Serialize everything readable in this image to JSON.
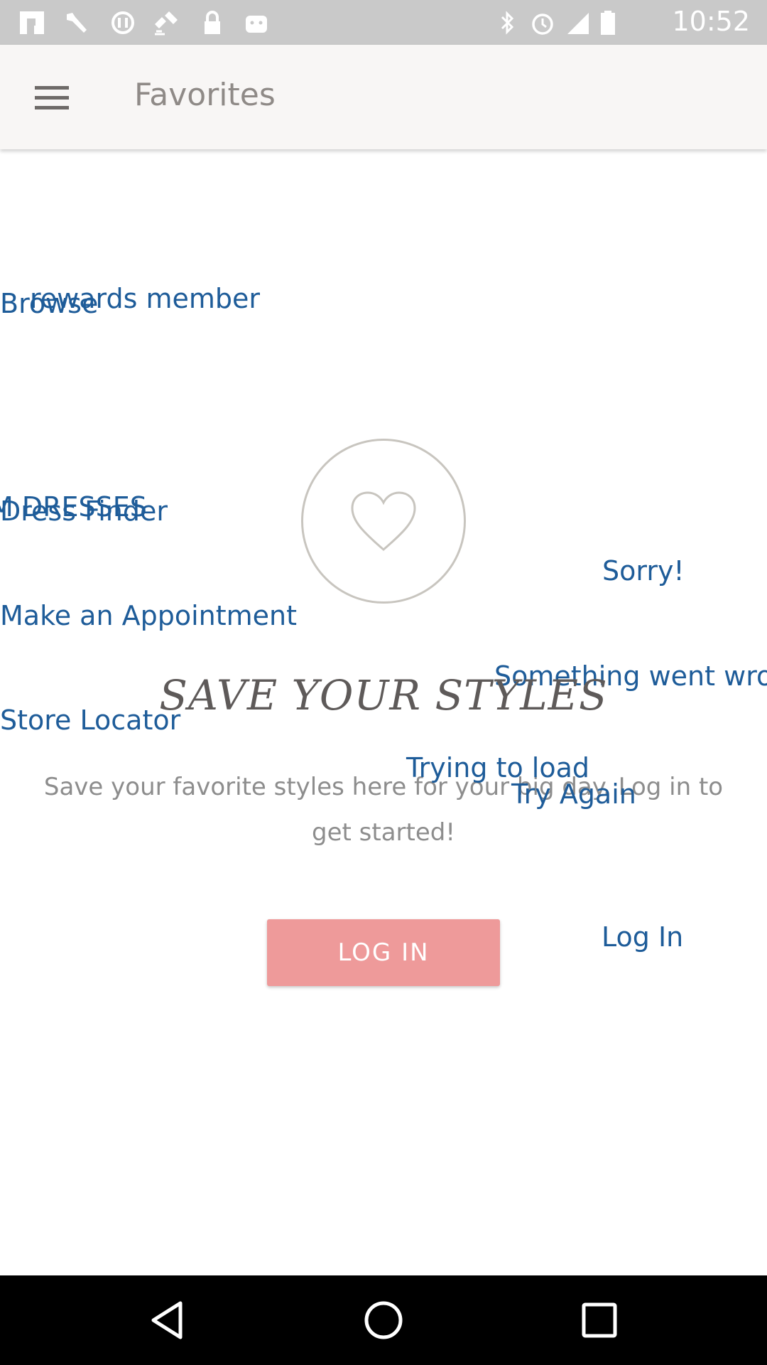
{
  "status_bar": {
    "time": "10:52",
    "left_icons": [
      "flipboard-icon",
      "wrench-icon",
      "cast-off-icon",
      "satellite-icon",
      "lock-icon",
      "android-icon"
    ],
    "right_icons": [
      "bluetooth-icon",
      "alarm-icon",
      "signal-icon",
      "battery-icon"
    ]
  },
  "app_bar": {
    "menu_icon": "hamburger-menu-icon",
    "title": "Favorites"
  },
  "drawer_overlay": {
    "rewards": "rewards member",
    "browse": "Browse",
    "prom_dresses": "M DRESSES",
    "dress_finder": "Dress Finder",
    "appointment": "Make an Appointment",
    "store_locator": "Store Locator"
  },
  "error_overlay": {
    "sorry": "Sorry!",
    "something_wrong": "Something went wro",
    "trying_to_load": "Trying to load",
    "try_again": "Try Again",
    "log_in_link": "Log In"
  },
  "empty_state": {
    "icon": "heart-icon",
    "headline": "SAVE YOUR STYLES",
    "description": "Save your favorite styles here for your big day. Log in to get started!",
    "login_button": "LOG IN"
  },
  "colors": {
    "accent_blue": "#1e5c99",
    "login_button": "#ee9a9a",
    "app_bar_bg": "#f8f6f5"
  },
  "nav_bar": {
    "icons": [
      "back-icon",
      "home-icon",
      "recents-icon"
    ]
  }
}
